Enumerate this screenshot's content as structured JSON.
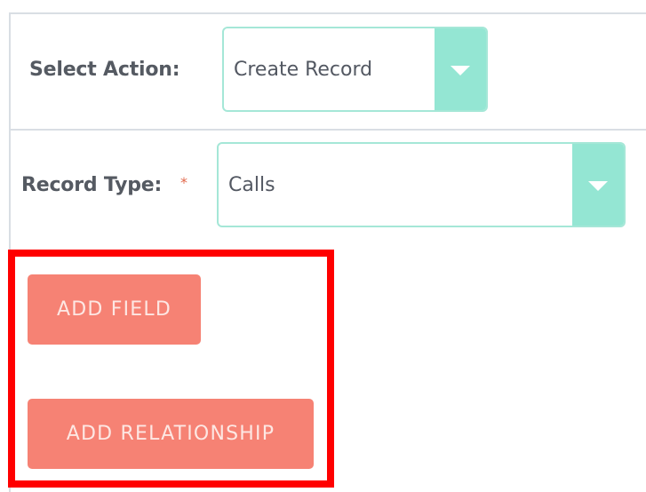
{
  "select_action": {
    "label": "Select Action:",
    "value": "Create Record"
  },
  "record_type": {
    "label": "Record Type:",
    "required_marker": "*",
    "value": "Calls"
  },
  "buttons": {
    "add_field": "ADD FIELD",
    "add_relationship": "ADD RELATIONSHIP"
  },
  "colors": {
    "select_border": "#a5e7d7",
    "select_caret_bg": "#94e6d3",
    "button_bg": "#f68274",
    "highlight_border": "#ff0000",
    "divider": "#d9dee4"
  },
  "icons": {
    "dropdown": "chevron-down-icon"
  }
}
